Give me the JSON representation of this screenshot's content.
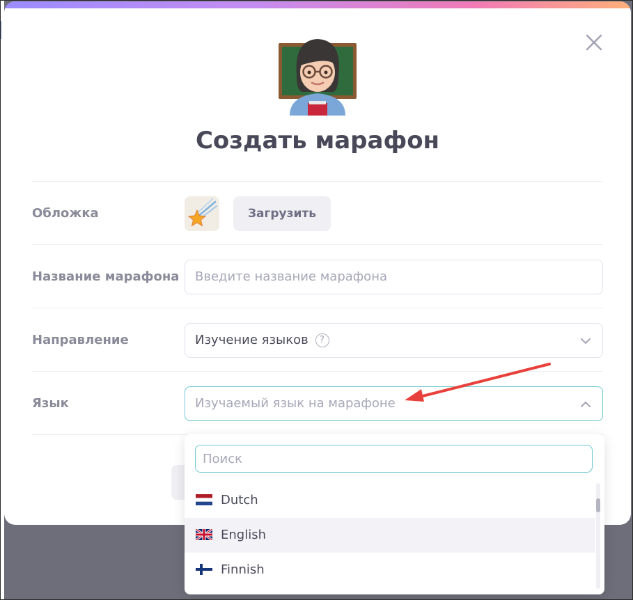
{
  "modal": {
    "title": "Создать марафон",
    "close_icon": "close-icon"
  },
  "form": {
    "cover": {
      "label": "Обложка",
      "upload_label": "Загрузить",
      "thumb_icon": "shooting-star-icon"
    },
    "name": {
      "label": "Название марафона",
      "placeholder": "Введите название марафона"
    },
    "direction": {
      "label": "Направление",
      "value": "Изучение языков",
      "help": "?"
    },
    "language": {
      "label": "Язык",
      "placeholder": "Изучаемый язык на марафоне"
    }
  },
  "dropdown": {
    "search_placeholder": "Поиск",
    "options": [
      {
        "label": "Dutch",
        "flag": "netherlands-flag"
      },
      {
        "label": "English",
        "flag": "uk-flag",
        "highlighted": true
      },
      {
        "label": "Finnish",
        "flag": "finland-flag"
      }
    ]
  },
  "colors": {
    "accent": "#6cc7d2",
    "arrow": "#e8403a",
    "title": "#484859"
  }
}
